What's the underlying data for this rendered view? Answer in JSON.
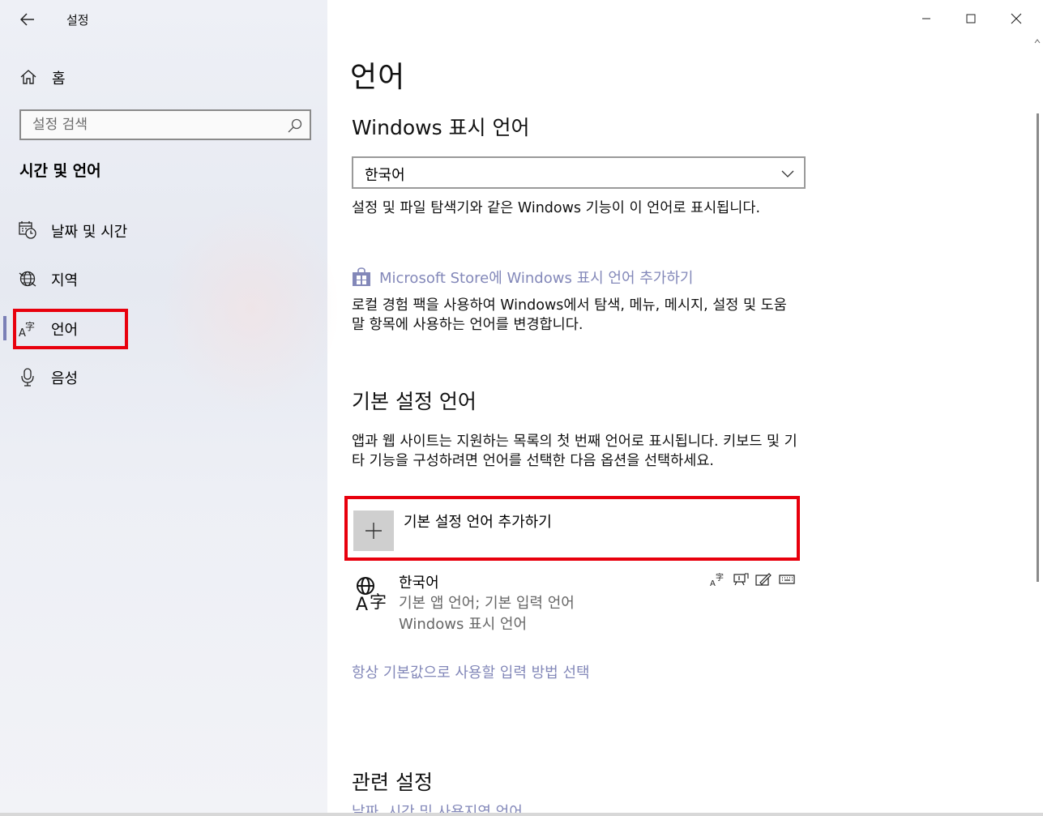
{
  "window": {
    "app_title": "설정",
    "minimize_icon": "minimize-icon",
    "maximize_icon": "maximize-icon",
    "close_icon": "close-icon"
  },
  "sidebar": {
    "home_label": "홈",
    "search_placeholder": "설정 검색",
    "section_title": "시간 및 언어",
    "items": [
      {
        "label": "날짜 및 시간",
        "icon": "calendar-clock-icon"
      },
      {
        "label": "지역",
        "icon": "globe-icon"
      },
      {
        "label": "언어",
        "icon": "language-icon",
        "selected": true
      },
      {
        "label": "음성",
        "icon": "microphone-icon"
      }
    ]
  },
  "main": {
    "page_title": "언어",
    "display_language": {
      "heading": "Windows 표시 언어",
      "selected_value": "한국어",
      "description": "설정 및 파일 탐색기와 같은 Windows 기능이 이 언어로 표시됩니다.",
      "store_link": "Microsoft Store에 Windows 표시 언어 추가하기",
      "store_description": "로컬 경험 팩을 사용하여 Windows에서 탐색, 메뉴, 메시지, 설정 및 도움말 항목에 사용하는 언어를 변경합니다."
    },
    "preferred_languages": {
      "heading": "기본 설정 언어",
      "description": "앱과 웹 사이트는 지원하는 목록의 첫 번째 언어로 표시됩니다. 키보드 및 기타 기능을 구성하려면 언어를 선택한 다음 옵션을 선택하세요.",
      "add_label": "기본 설정 언어 추가하기",
      "languages": [
        {
          "name": "한국어",
          "line1": "기본 앱 언어; 기본 입력 언어",
          "line2": "Windows 표시 언어",
          "feature_icons": [
            "language-pack-icon",
            "speech-icon",
            "handwriting-icon",
            "keyboard-icon"
          ]
        }
      ]
    },
    "input_method_link": "항상 기본값으로 사용할 입력 방법 선택",
    "related": {
      "heading": "관련 설정",
      "first_link": "날짜, 시간 및 사용지역 언어"
    }
  },
  "colors": {
    "accent_link": "#8388b9",
    "highlight_box": "#e8000d",
    "selection_bar": "#7a7fb6"
  }
}
